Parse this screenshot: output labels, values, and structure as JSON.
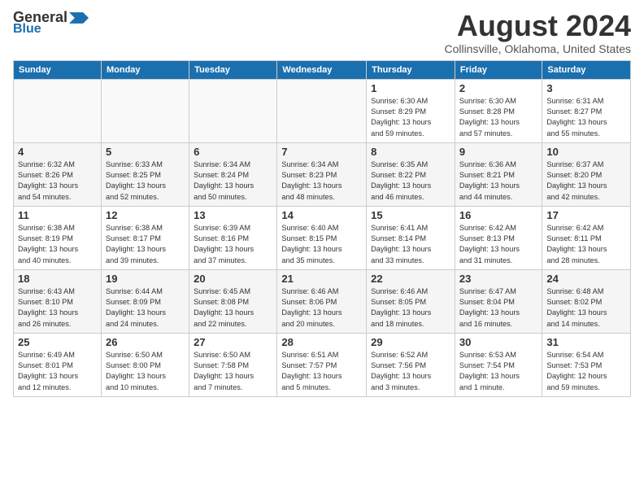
{
  "logo": {
    "general": "General",
    "blue": "Blue"
  },
  "title": "August 2024",
  "subtitle": "Collinsville, Oklahoma, United States",
  "days_of_week": [
    "Sunday",
    "Monday",
    "Tuesday",
    "Wednesday",
    "Thursday",
    "Friday",
    "Saturday"
  ],
  "weeks": [
    [
      {
        "day": "",
        "info": ""
      },
      {
        "day": "",
        "info": ""
      },
      {
        "day": "",
        "info": ""
      },
      {
        "day": "",
        "info": ""
      },
      {
        "day": "1",
        "info": "Sunrise: 6:30 AM\nSunset: 8:29 PM\nDaylight: 13 hours\nand 59 minutes."
      },
      {
        "day": "2",
        "info": "Sunrise: 6:30 AM\nSunset: 8:28 PM\nDaylight: 13 hours\nand 57 minutes."
      },
      {
        "day": "3",
        "info": "Sunrise: 6:31 AM\nSunset: 8:27 PM\nDaylight: 13 hours\nand 55 minutes."
      }
    ],
    [
      {
        "day": "4",
        "info": "Sunrise: 6:32 AM\nSunset: 8:26 PM\nDaylight: 13 hours\nand 54 minutes."
      },
      {
        "day": "5",
        "info": "Sunrise: 6:33 AM\nSunset: 8:25 PM\nDaylight: 13 hours\nand 52 minutes."
      },
      {
        "day": "6",
        "info": "Sunrise: 6:34 AM\nSunset: 8:24 PM\nDaylight: 13 hours\nand 50 minutes."
      },
      {
        "day": "7",
        "info": "Sunrise: 6:34 AM\nSunset: 8:23 PM\nDaylight: 13 hours\nand 48 minutes."
      },
      {
        "day": "8",
        "info": "Sunrise: 6:35 AM\nSunset: 8:22 PM\nDaylight: 13 hours\nand 46 minutes."
      },
      {
        "day": "9",
        "info": "Sunrise: 6:36 AM\nSunset: 8:21 PM\nDaylight: 13 hours\nand 44 minutes."
      },
      {
        "day": "10",
        "info": "Sunrise: 6:37 AM\nSunset: 8:20 PM\nDaylight: 13 hours\nand 42 minutes."
      }
    ],
    [
      {
        "day": "11",
        "info": "Sunrise: 6:38 AM\nSunset: 8:19 PM\nDaylight: 13 hours\nand 40 minutes."
      },
      {
        "day": "12",
        "info": "Sunrise: 6:38 AM\nSunset: 8:17 PM\nDaylight: 13 hours\nand 39 minutes."
      },
      {
        "day": "13",
        "info": "Sunrise: 6:39 AM\nSunset: 8:16 PM\nDaylight: 13 hours\nand 37 minutes."
      },
      {
        "day": "14",
        "info": "Sunrise: 6:40 AM\nSunset: 8:15 PM\nDaylight: 13 hours\nand 35 minutes."
      },
      {
        "day": "15",
        "info": "Sunrise: 6:41 AM\nSunset: 8:14 PM\nDaylight: 13 hours\nand 33 minutes."
      },
      {
        "day": "16",
        "info": "Sunrise: 6:42 AM\nSunset: 8:13 PM\nDaylight: 13 hours\nand 31 minutes."
      },
      {
        "day": "17",
        "info": "Sunrise: 6:42 AM\nSunset: 8:11 PM\nDaylight: 13 hours\nand 28 minutes."
      }
    ],
    [
      {
        "day": "18",
        "info": "Sunrise: 6:43 AM\nSunset: 8:10 PM\nDaylight: 13 hours\nand 26 minutes."
      },
      {
        "day": "19",
        "info": "Sunrise: 6:44 AM\nSunset: 8:09 PM\nDaylight: 13 hours\nand 24 minutes."
      },
      {
        "day": "20",
        "info": "Sunrise: 6:45 AM\nSunset: 8:08 PM\nDaylight: 13 hours\nand 22 minutes."
      },
      {
        "day": "21",
        "info": "Sunrise: 6:46 AM\nSunset: 8:06 PM\nDaylight: 13 hours\nand 20 minutes."
      },
      {
        "day": "22",
        "info": "Sunrise: 6:46 AM\nSunset: 8:05 PM\nDaylight: 13 hours\nand 18 minutes."
      },
      {
        "day": "23",
        "info": "Sunrise: 6:47 AM\nSunset: 8:04 PM\nDaylight: 13 hours\nand 16 minutes."
      },
      {
        "day": "24",
        "info": "Sunrise: 6:48 AM\nSunset: 8:02 PM\nDaylight: 13 hours\nand 14 minutes."
      }
    ],
    [
      {
        "day": "25",
        "info": "Sunrise: 6:49 AM\nSunset: 8:01 PM\nDaylight: 13 hours\nand 12 minutes."
      },
      {
        "day": "26",
        "info": "Sunrise: 6:50 AM\nSunset: 8:00 PM\nDaylight: 13 hours\nand 10 minutes."
      },
      {
        "day": "27",
        "info": "Sunrise: 6:50 AM\nSunset: 7:58 PM\nDaylight: 13 hours\nand 7 minutes."
      },
      {
        "day": "28",
        "info": "Sunrise: 6:51 AM\nSunset: 7:57 PM\nDaylight: 13 hours\nand 5 minutes."
      },
      {
        "day": "29",
        "info": "Sunrise: 6:52 AM\nSunset: 7:56 PM\nDaylight: 13 hours\nand 3 minutes."
      },
      {
        "day": "30",
        "info": "Sunrise: 6:53 AM\nSunset: 7:54 PM\nDaylight: 13 hours\nand 1 minute."
      },
      {
        "day": "31",
        "info": "Sunrise: 6:54 AM\nSunset: 7:53 PM\nDaylight: 12 hours\nand 59 minutes."
      }
    ]
  ]
}
